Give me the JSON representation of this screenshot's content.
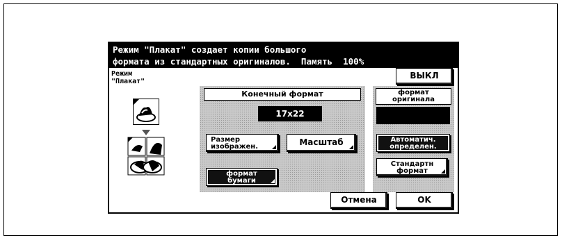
{
  "header": {
    "line1": "Режим \"Плакат\" создает копии большого",
    "line2": "формата из стандартных оригиналов.  Память  100%"
  },
  "mode_label": {
    "line1": "Режим",
    "line2": "\"Плакат\""
  },
  "off_button": "ВЫКЛ",
  "final_format": {
    "title": "Конечный формат",
    "value": "17x22",
    "image_size_button": {
      "line1": "Размер",
      "line2": "изображен."
    },
    "zoom_button": "Масштаб",
    "paper_format_button": {
      "line1": "формат",
      "line2": "бумаги"
    }
  },
  "original_format": {
    "title_line1": "формат",
    "title_line2": "оригинала",
    "value": "",
    "auto_button": {
      "line1": "Автоматич.",
      "line2": "определен."
    },
    "standard_button": {
      "line1": "Стандартн",
      "line2": "формат"
    }
  },
  "footer": {
    "cancel": "Отмена",
    "ok": "OK"
  },
  "icons": [
    "single-original-icon",
    "down-arrow-icon",
    "poster-split-icon"
  ]
}
